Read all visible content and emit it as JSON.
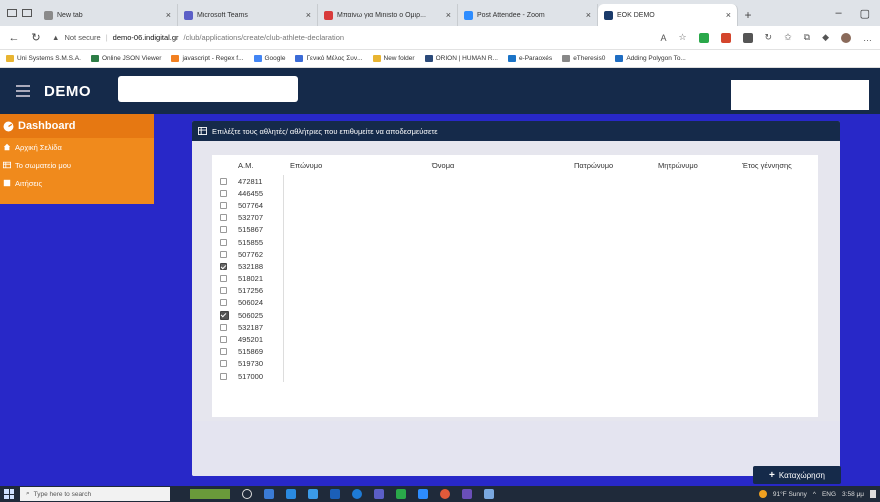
{
  "browser": {
    "tabs": [
      {
        "title": "New tab",
        "color": "#8a8a8a",
        "active": false
      },
      {
        "title": "Microsoft Teams",
        "color": "#5b5fc7",
        "active": false
      },
      {
        "title": "Μπαίνω για Ministo ο Ομιρ...",
        "color": "#d83b3b",
        "active": false
      },
      {
        "title": "Post Attendee - Zoom",
        "color": "#2d8cff",
        "active": false
      },
      {
        "title": "EOK DEMO",
        "color": "#1a3a6a",
        "active": true
      }
    ],
    "address": {
      "security_label": "Not secure",
      "host": "demo-06.indigital.gr",
      "path": "/club/applications/create/club-athlete-declaration"
    },
    "bookmarks": [
      {
        "label": "Uni Systems S.M.S.A.",
        "color": "#e8b431"
      },
      {
        "label": "Online JSON Viewer",
        "color": "#2d7d46"
      },
      {
        "label": "javascript - Regex f...",
        "color": "#f28021"
      },
      {
        "label": "Google",
        "color": "#4285f4"
      },
      {
        "label": "Γενικό Μέλος Συν...",
        "color": "#3b6bd6"
      },
      {
        "label": "New folder",
        "color": "#e8b431"
      },
      {
        "label": "ORION | HUMAN R...",
        "color": "#2b4a7a"
      },
      {
        "label": "e-Paraoxés",
        "color": "#1a73c7"
      },
      {
        "label": "eTheresis0",
        "color": "#888888"
      },
      {
        "label": "Adding Polygon To...",
        "color": "#1f6dc2"
      }
    ]
  },
  "app": {
    "brand": "DEMO",
    "sidebar": {
      "dashboard": "Dashboard",
      "items": [
        "Αρχική Σελίδα",
        "Το σωματείο μου",
        "Αιτήσεις"
      ]
    },
    "card_title": "Επιλέξτε τους αθλητές/ αθλήτριες που επιθυμείτε να αποδεσμεύσετε",
    "columns": [
      "Α.Μ.",
      "Επώνυμο",
      "Όνομα",
      "Πατρώνυμο",
      "Μητρώνυμο",
      "Έτος γέννησης"
    ],
    "rows": [
      {
        "am": "472811",
        "checked": false
      },
      {
        "am": "446455",
        "checked": false
      },
      {
        "am": "507764",
        "checked": false
      },
      {
        "am": "532707",
        "checked": false
      },
      {
        "am": "515867",
        "checked": false
      },
      {
        "am": "515855",
        "checked": false
      },
      {
        "am": "507762",
        "checked": false
      },
      {
        "am": "532188",
        "checked": true
      },
      {
        "am": "518021",
        "checked": false
      },
      {
        "am": "517256",
        "checked": false
      },
      {
        "am": "506024",
        "checked": false
      },
      {
        "am": "506025",
        "checked": true
      },
      {
        "am": "532187",
        "checked": false
      },
      {
        "am": "495201",
        "checked": false
      },
      {
        "am": "515869",
        "checked": false
      },
      {
        "am": "519730",
        "checked": false
      },
      {
        "am": "517000",
        "checked": false
      }
    ],
    "save_button": "Καταχώρηση"
  },
  "taskbar": {
    "search_placeholder": "Type here to search",
    "weather": "91°F Sunny",
    "lang": "ENG",
    "time": "3:58 μμ"
  }
}
